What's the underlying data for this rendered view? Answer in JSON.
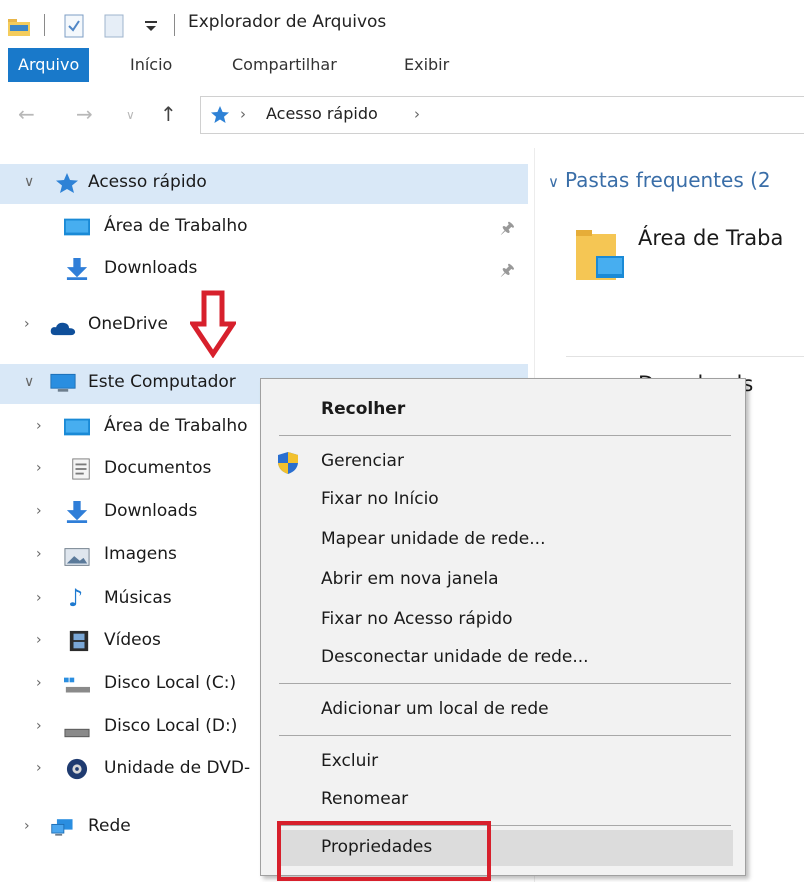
{
  "window": {
    "title": "Explorador de Arquivos"
  },
  "ribbon": {
    "tabs": [
      {
        "label": "Arquivo",
        "active": true
      },
      {
        "label": "Início",
        "active": false
      },
      {
        "label": "Compartilhar",
        "active": false
      },
      {
        "label": "Exibir",
        "active": false
      }
    ]
  },
  "address": {
    "path": [
      "Acesso rápido"
    ]
  },
  "nav": {
    "quick_access": "Acesso rápido",
    "desktop": "Área de Trabalho",
    "downloads": "Downloads",
    "onedrive": "OneDrive",
    "this_pc": "Este Computador",
    "pc_items": [
      {
        "label": "Área de Trabalho",
        "icon": "desktop-folder-icon"
      },
      {
        "label": "Documentos",
        "icon": "documents-icon"
      },
      {
        "label": "Downloads",
        "icon": "downloads-icon"
      },
      {
        "label": "Imagens",
        "icon": "pictures-icon"
      },
      {
        "label": "Músicas",
        "icon": "music-icon"
      },
      {
        "label": "Vídeos",
        "icon": "videos-icon"
      },
      {
        "label": "Disco Local (C:)",
        "icon": "system-drive-icon"
      },
      {
        "label": "Disco Local (D:)",
        "icon": "drive-icon"
      },
      {
        "label": "Unidade de DVD-",
        "icon": "dvd-drive-icon"
      }
    ],
    "network": "Rede"
  },
  "content": {
    "section_title": "Pastas frequentes (2",
    "tiles": [
      "Área de Traba",
      "Downloads"
    ]
  },
  "context_menu": {
    "items": {
      "collapse": "Recolher",
      "manage": "Gerenciar",
      "pin_start": "Fixar no Início",
      "map_drive": "Mapear unidade de rede...",
      "open_new_window": "Abrir em nova janela",
      "pin_quick_access": "Fixar no Acesso rápido",
      "disconnect_drive": "Desconectar unidade de rede...",
      "add_network_location": "Adicionar um local de rede",
      "delete": "Excluir",
      "rename": "Renomear",
      "properties": "Propriedades"
    }
  },
  "colors": {
    "accent": "#1979ca",
    "selection": "#d9e8f7",
    "highlight": "#d7202c"
  }
}
